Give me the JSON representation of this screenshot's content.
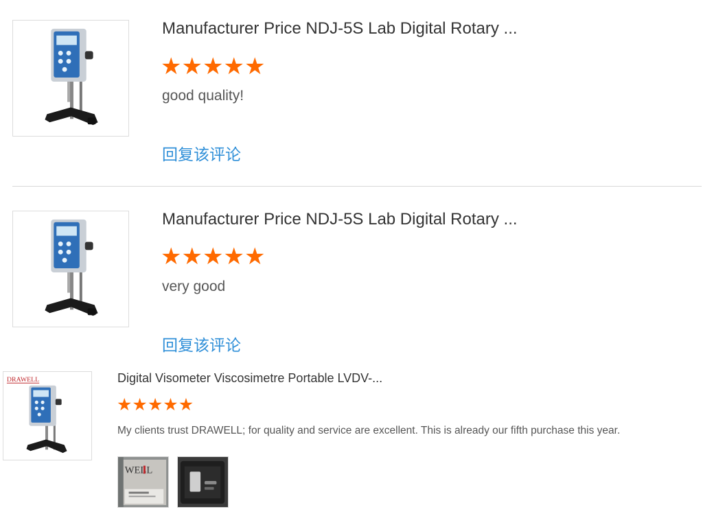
{
  "reviews": [
    {
      "product_title": "Manufacturer Price NDJ-5S Lab Digital Rotary ...",
      "rating": 5,
      "stars": [
        "★",
        "★",
        "★",
        "★",
        "★"
      ],
      "comment": "good quality!",
      "reply_label": "回复该评论"
    },
    {
      "product_title": "Manufacturer Price NDJ-5S Lab Digital Rotary ...",
      "rating": 5,
      "stars": [
        "★",
        "★",
        "★",
        "★",
        "★"
      ],
      "comment": "very good",
      "reply_label": "回复该评论"
    },
    {
      "product_title": "Digital Visometer Viscosimetre Portable LVDV-...",
      "rating": 5,
      "stars": [
        "★",
        "★",
        "★",
        "★",
        "★"
      ],
      "comment": "My clients trust DRAWELL; for quality and service are excellent. This is already our fifth purchase this year.",
      "brand_logo_text": "DRAWELL",
      "photo_logo_text": "WELL"
    }
  ],
  "colors": {
    "star": "#ff6a00",
    "reply_link": "#2f8fd8",
    "title": "#333333",
    "comment": "#555555",
    "divider": "#d8d8d8"
  }
}
